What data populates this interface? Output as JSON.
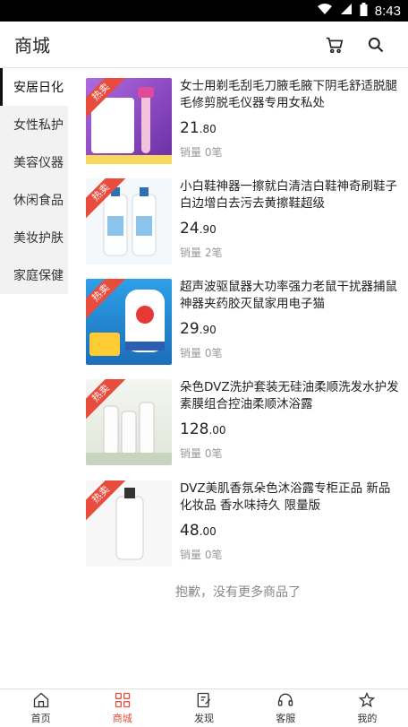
{
  "status": {
    "time": "8:43"
  },
  "appbar": {
    "title": "商城"
  },
  "sidebar": {
    "items": [
      {
        "label": "安居日化"
      },
      {
        "label": "女性私护"
      },
      {
        "label": "美容仪器"
      },
      {
        "label": "休闲食品"
      },
      {
        "label": "美妆护肤"
      },
      {
        "label": "家庭保健"
      }
    ]
  },
  "products": [
    {
      "badge": "热卖",
      "name": "女士用剃毛刮毛刀腋毛腋下阴毛舒适脱腿毛修剪脱毛仪器专用女私处",
      "price_int": "21",
      "price_dec": ".80",
      "sold": "销量 0笔",
      "thumb_color": "#8a4fc7"
    },
    {
      "badge": "热卖",
      "name": "小白鞋神器一擦就白清洁白鞋神奇刷鞋子白边增白去污去黄擦鞋超级",
      "price_int": "24",
      "price_dec": ".90",
      "sold": "销量 2笔",
      "thumb_color": "#d9ecf7"
    },
    {
      "badge": "热卖",
      "name": "超声波驱鼠器大功率强力老鼠干扰器捕鼠神器夹药胶灭鼠家用电子猫",
      "price_int": "29",
      "price_dec": ".90",
      "sold": "销量 0笔",
      "thumb_color": "#1e8bd6"
    },
    {
      "badge": "热卖",
      "name": "朵色DVZ洗护套装无硅油柔顺洗发水护发素膜组合控油柔顺沐浴露",
      "price_int": "128",
      "price_dec": ".00",
      "sold": "销量 0笔",
      "thumb_color": "#eef1ea"
    },
    {
      "badge": "热卖",
      "name": "DVZ美肌香氛朵色沐浴露专柜正品 新品化妆品 香水味持久 限量版",
      "price_int": "48",
      "price_dec": ".00",
      "sold": "销量 0笔",
      "thumb_color": "#f6f6f6"
    }
  ],
  "no_more": "抱歉，没有更多商品了",
  "tabs": [
    {
      "label": "首页"
    },
    {
      "label": "商城"
    },
    {
      "label": "发现"
    },
    {
      "label": "客服"
    },
    {
      "label": "我的"
    }
  ]
}
